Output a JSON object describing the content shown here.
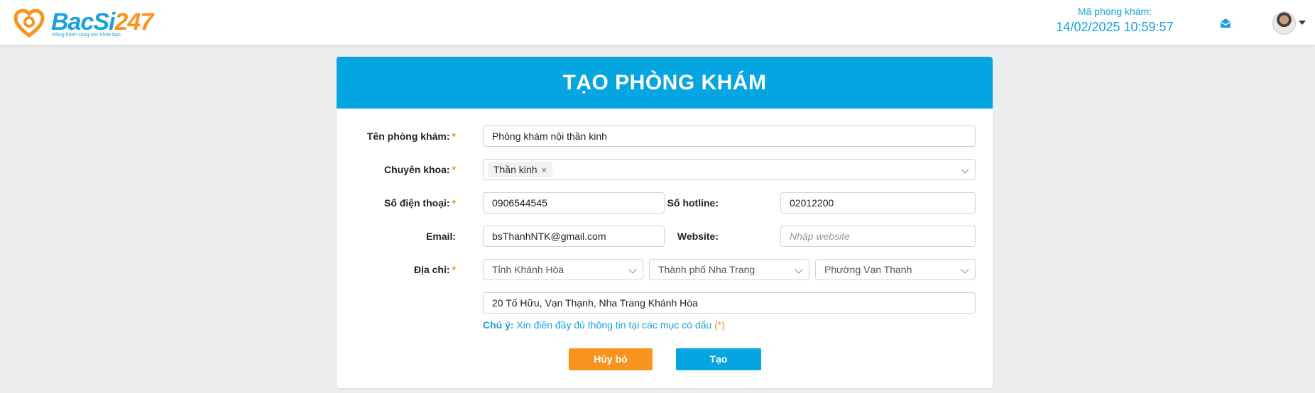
{
  "header": {
    "logo": {
      "brand": "BacSi",
      "brand_num": "247",
      "tagline": "Đồng hành cùng sức khỏe bạn"
    },
    "clinic_code_label": "Mã phòng khám:",
    "datetime": "14/02/2025 10:59:57",
    "colors": {
      "accent": "#1aa1dc",
      "orange": "#f7941d"
    }
  },
  "form": {
    "title": "TẠO PHÒNG KHÁM",
    "header_color": "#04a5e0",
    "clinic_name": {
      "label": "Tên phòng khám:",
      "required": "*",
      "value": "Phòng khám nội thần kinh"
    },
    "specialty": {
      "label": "Chuyên khoa:",
      "required": "*",
      "tags": [
        "Thần kinh"
      ],
      "remove_icon": "×"
    },
    "phone": {
      "label": "Số điện thoại:",
      "required": "*",
      "value": "0906544545"
    },
    "hotline": {
      "label": "Số hotline:",
      "value": "02012200"
    },
    "email": {
      "label": "Email:",
      "value": "bsThanhNTK@gmail.com"
    },
    "website": {
      "label": "Website:",
      "value": "",
      "placeholder": "Nhập website"
    },
    "address": {
      "label": "Địa chỉ:",
      "required": "*",
      "province": "Tỉnh Khánh Hòa",
      "city": "Thành phố Nha Trang",
      "ward": "Phường Vạn Thạnh",
      "street": "20 Tố Hữu, Vạn Thạnh, Nha Trang Khánh Hòa"
    },
    "note": {
      "prefix": "Chú ý:",
      "text": " Xin điền đầy đủ thông tin tại các mục có dấu ",
      "mark": "(*)"
    },
    "buttons": {
      "cancel": "Hủy bỏ",
      "create": "Tạo"
    }
  }
}
